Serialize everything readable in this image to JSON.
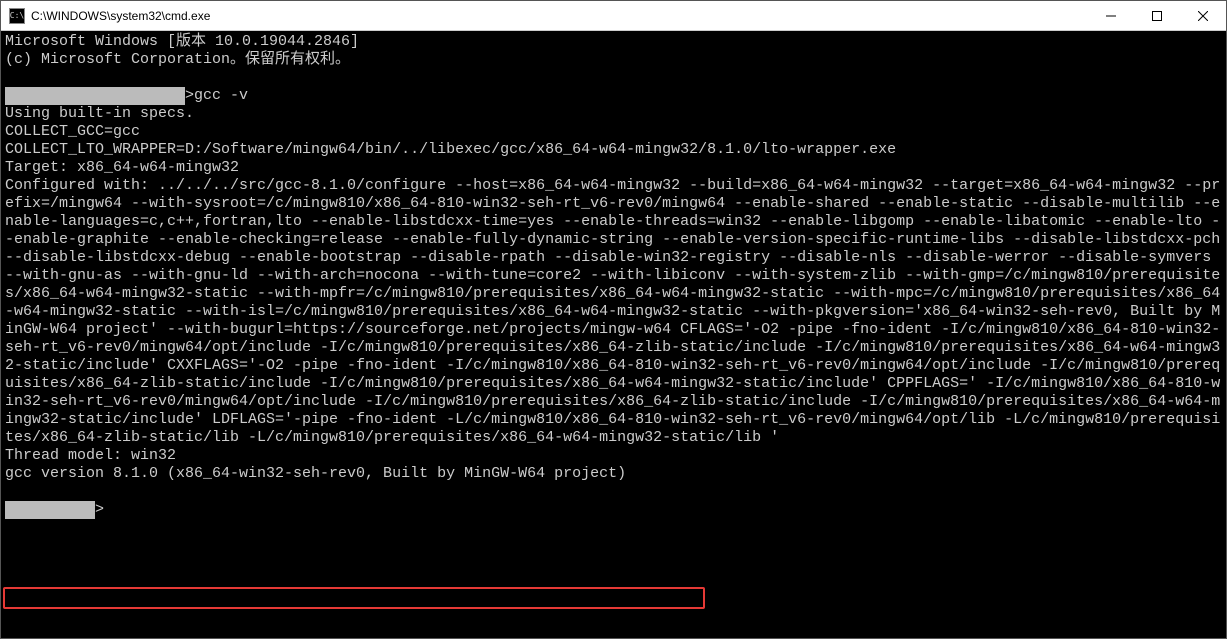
{
  "window": {
    "icon_label": "C:\\",
    "title": "C:\\WINDOWS\\system32\\cmd.exe"
  },
  "controls": {
    "minimize": "—",
    "maximize": "□",
    "close": "✕"
  },
  "console": {
    "line1": "Microsoft Windows [版本 10.0.19044.2846]",
    "line2": "(c) Microsoft Corporation。保留所有权利。",
    "blank": "",
    "redacted1": "                    ",
    "prompt_cmd": ">gcc -v",
    "using": "Using built-in specs.",
    "collect_gcc": "COLLECT_GCC=gcc",
    "collect_lto": "COLLECT_LTO_WRAPPER=D:/Software/mingw64/bin/../libexec/gcc/x86_64-w64-mingw32/8.1.0/lto-wrapper.exe",
    "target": "Target: x86_64-w64-mingw32",
    "configured": "Configured with: ../../../src/gcc-8.1.0/configure --host=x86_64-w64-mingw32 --build=x86_64-w64-mingw32 --target=x86_64-w64-mingw32 --prefix=/mingw64 --with-sysroot=/c/mingw810/x86_64-810-win32-seh-rt_v6-rev0/mingw64 --enable-shared --enable-static --disable-multilib --enable-languages=c,c++,fortran,lto --enable-libstdcxx-time=yes --enable-threads=win32 --enable-libgomp --enable-libatomic --enable-lto --enable-graphite --enable-checking=release --enable-fully-dynamic-string --enable-version-specific-runtime-libs --disable-libstdcxx-pch --disable-libstdcxx-debug --enable-bootstrap --disable-rpath --disable-win32-registry --disable-nls --disable-werror --disable-symvers --with-gnu-as --with-gnu-ld --with-arch=nocona --with-tune=core2 --with-libiconv --with-system-zlib --with-gmp=/c/mingw810/prerequisites/x86_64-w64-mingw32-static --with-mpfr=/c/mingw810/prerequisites/x86_64-w64-mingw32-static --with-mpc=/c/mingw810/prerequisites/x86_64-w64-mingw32-static --with-isl=/c/mingw810/prerequisites/x86_64-w64-mingw32-static --with-pkgversion='x86_64-win32-seh-rev0, Built by MinGW-W64 project' --with-bugurl=https://sourceforge.net/projects/mingw-w64 CFLAGS='-O2 -pipe -fno-ident -I/c/mingw810/x86_64-810-win32-seh-rt_v6-rev0/mingw64/opt/include -I/c/mingw810/prerequisites/x86_64-zlib-static/include -I/c/mingw810/prerequisites/x86_64-w64-mingw32-static/include' CXXFLAGS='-O2 -pipe -fno-ident -I/c/mingw810/x86_64-810-win32-seh-rt_v6-rev0/mingw64/opt/include -I/c/mingw810/prerequisites/x86_64-zlib-static/include -I/c/mingw810/prerequisites/x86_64-w64-mingw32-static/include' CPPFLAGS=' -I/c/mingw810/x86_64-810-win32-seh-rt_v6-rev0/mingw64/opt/include -I/c/mingw810/prerequisites/x86_64-zlib-static/include -I/c/mingw810/prerequisites/x86_64-w64-mingw32-static/include' LDFLAGS='-pipe -fno-ident -L/c/mingw810/x86_64-810-win32-seh-rt_v6-rev0/mingw64/opt/lib -L/c/mingw810/prerequisites/x86_64-zlib-static/lib -L/c/mingw810/prerequisites/x86_64-w64-mingw32-static/lib '",
    "thread_model": "Thread model: win32",
    "gcc_version": "gcc version 8.1.0 (x86_64-win32-seh-rev0, Built by MinGW-W64 project)",
    "redacted2": "          ",
    "cursor_suffix": ">"
  }
}
